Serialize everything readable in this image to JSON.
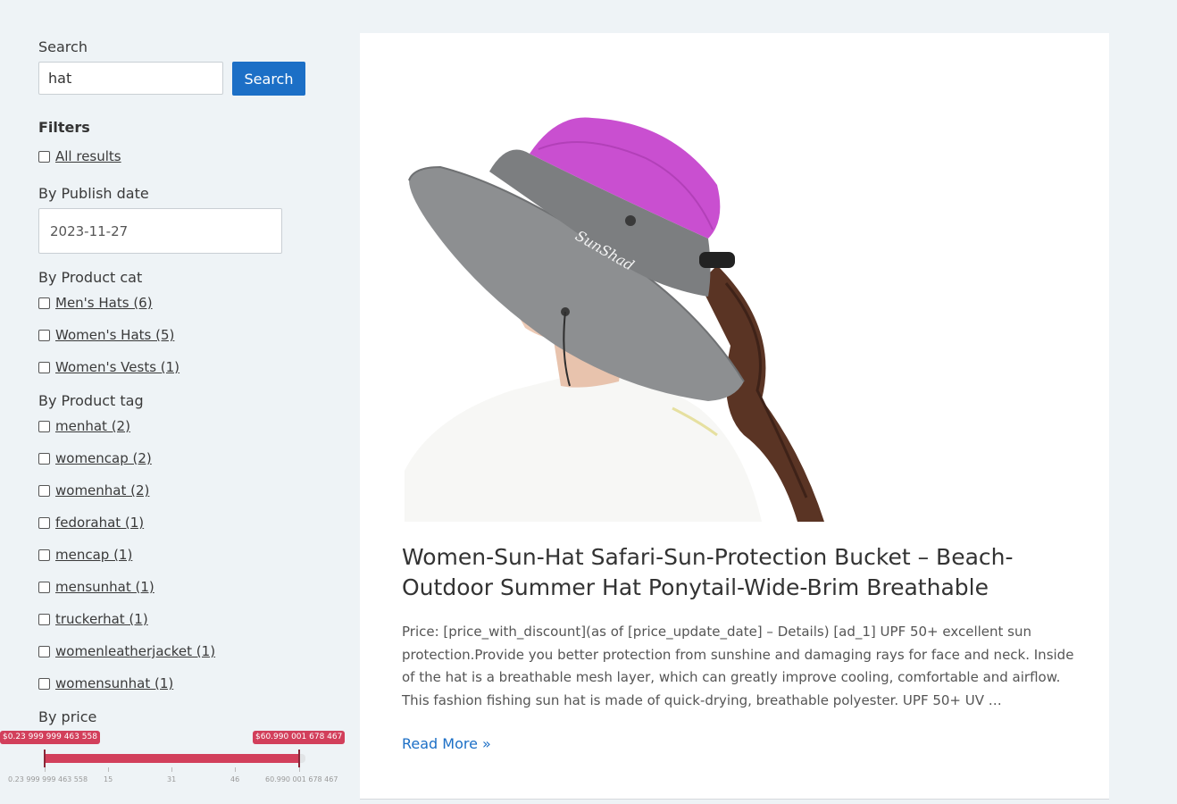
{
  "search": {
    "label": "Search",
    "value": "hat",
    "button_label": "Search"
  },
  "filters": {
    "heading": "Filters",
    "all_results": "All results",
    "publish_date": {
      "label": "By Publish date",
      "value": "2023-11-27"
    },
    "product_cat": {
      "label": "By Product cat",
      "items": [
        "Men's Hats (6)",
        "Women's Hats (5)",
        "Women's Vests (1)"
      ]
    },
    "product_tag": {
      "label": "By Product tag",
      "items": [
        "menhat (2)",
        "womencap (2)",
        "womenhat (2)",
        "fedorahat (1)",
        "mencap (1)",
        "mensunhat (1)",
        "truckerhat (1)",
        "womenleatherjacket (1)",
        "womensunhat (1)"
      ]
    },
    "price": {
      "label": "By price",
      "min_tag": "$0.23 999 999 463 558",
      "max_tag": "$60.990 001 678 467",
      "range": [
        0.23999999463558,
        60.990001678467
      ],
      "tick_labels": [
        "0.23 999 999 463 558",
        "15",
        "31",
        "46",
        "60.990 001 678 467"
      ]
    }
  },
  "post": {
    "title": "Women-Sun-Hat Safari-Sun-Protection Bucket – Beach-Outdoor Summer Hat Ponytail-Wide-Brim Breathable",
    "excerpt": "Price: [price_with_discount](as of [price_update_date] – Details) [ad_1] UPF 50+ excellent sun protection.Provide you better protection from sunshine and damaging rays for face and neck. Inside of the hat is a breathable mesh layer, which can greatly improve cooling, comfortable and airflow. This fashion fishing sun hat is made of quick-drying, breathable polyester. UPF 50+ UV …",
    "read_more": "Read More »",
    "image_brand_text": "SunShad"
  },
  "colors": {
    "accent": "#1c6fc6",
    "price_slider": "#d23f5b",
    "background": "#eef3f6",
    "hat_crown": "#c94fd0",
    "hat_brim": "#8d8f91"
  }
}
